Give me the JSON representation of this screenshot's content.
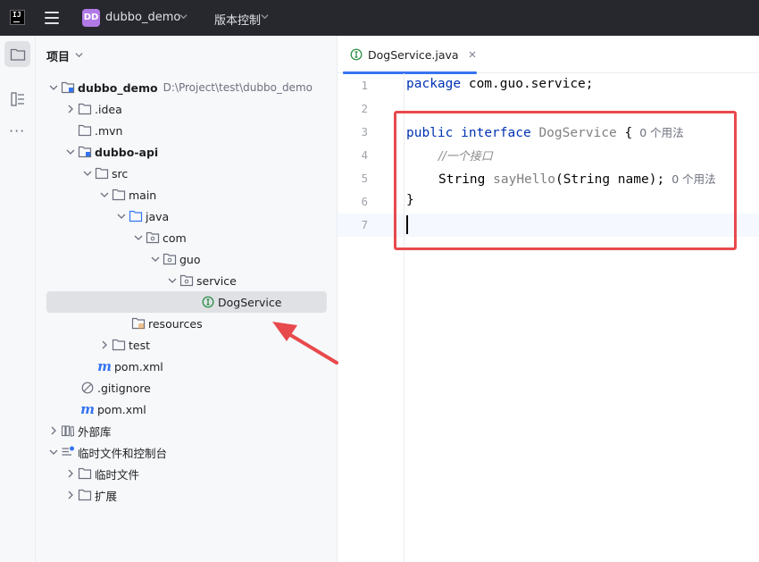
{
  "titlebar": {
    "logo_text": "IJ",
    "project_badge": "DD",
    "project_name": "dubbo_demo",
    "vcs_label": "版本控制"
  },
  "panel": {
    "title": "项目"
  },
  "tree": [
    {
      "label": "dubbo_demo",
      "path": "D:\\Project\\test\\dubbo_demo"
    },
    {
      "label": ".idea"
    },
    {
      "label": ".mvn"
    },
    {
      "label": "dubbo-api"
    },
    {
      "label": "src"
    },
    {
      "label": "main"
    },
    {
      "label": "java"
    },
    {
      "label": "com"
    },
    {
      "label": "guo"
    },
    {
      "label": "service"
    },
    {
      "label": "DogService"
    },
    {
      "label": "resources"
    },
    {
      "label": "test"
    },
    {
      "label": "pom.xml"
    },
    {
      "label": ".gitignore"
    },
    {
      "label": "pom.xml"
    },
    {
      "label": "外部库"
    },
    {
      "label": "临时文件和控制台"
    },
    {
      "label": "临时文件"
    },
    {
      "label": "扩展"
    }
  ],
  "editor": {
    "tab_label": "DogService.java",
    "line_numbers": [
      "1",
      "2",
      "3",
      "4",
      "5",
      "6",
      "7"
    ],
    "code": {
      "l1_kw": "package",
      "l1_rest": " com.guo.service;",
      "l3_kw1": "public",
      "l3_kw2": "interface",
      "l3_name": "DogService",
      "l3_brace": " {",
      "l3_hint": "0 个用法",
      "l4_comment": "//一个接口",
      "l5_type": "String",
      "l5_method": "sayHello",
      "l5_params": "(String name);",
      "l5_hint": "0 个用法",
      "l6_brace": "}"
    }
  },
  "colors": {
    "accent": "#3574f0",
    "annotation": "#e8494d",
    "keyword": "#0033b3"
  }
}
